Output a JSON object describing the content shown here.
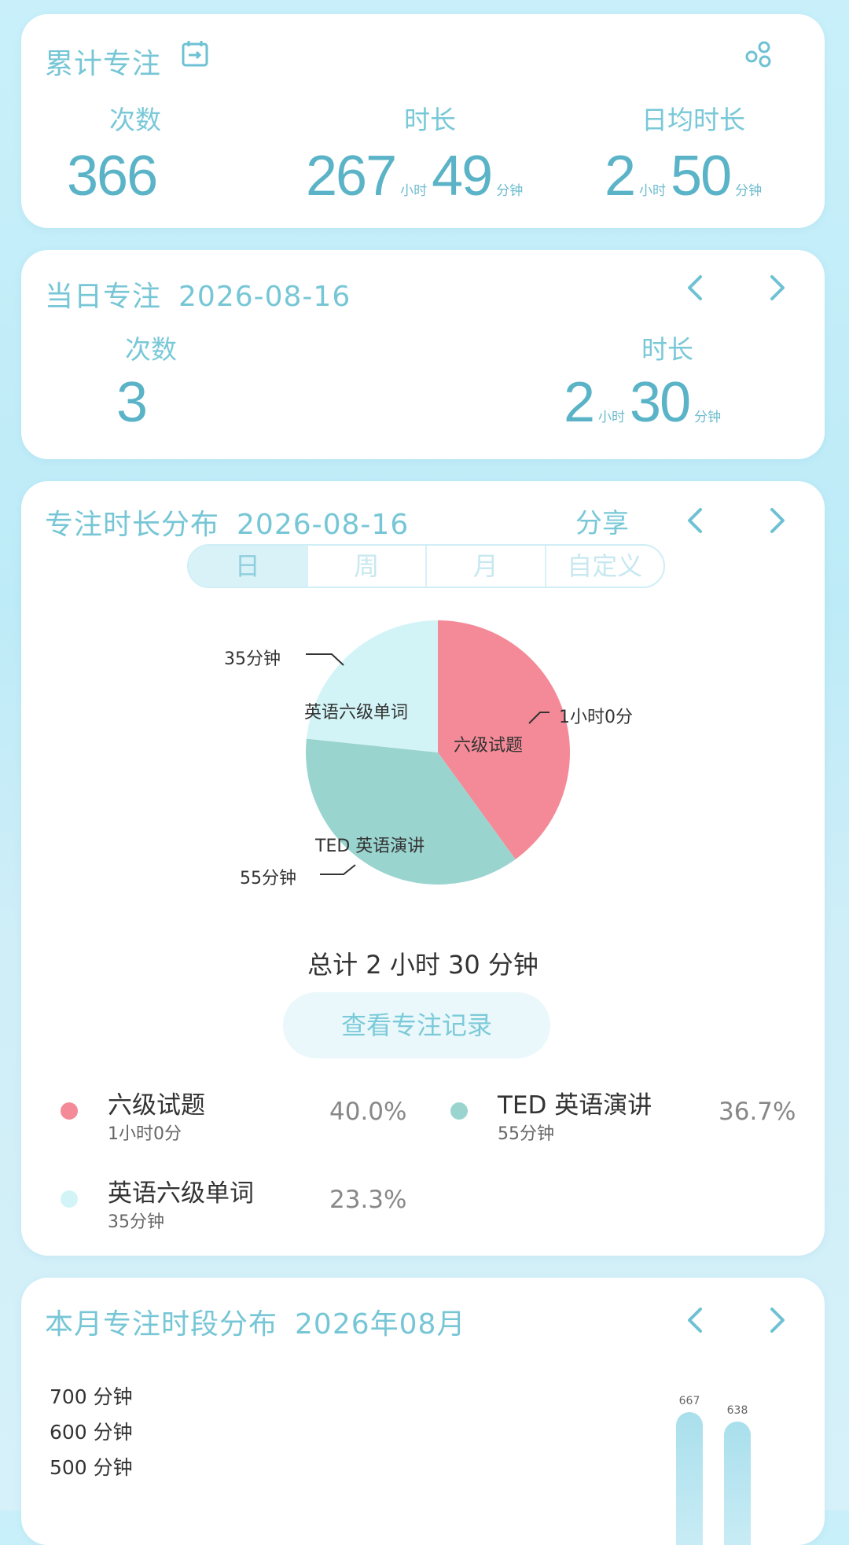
{
  "cumulative": {
    "title": "累计专注",
    "count_label": "次数",
    "count_value": "366",
    "duration_label": "时长",
    "duration_hours": "267",
    "duration_hours_unit": "小时",
    "duration_minutes": "49",
    "duration_minutes_unit": "分钟",
    "daily_avg_label": "日均时长",
    "daily_avg_hours": "2",
    "daily_avg_hours_unit": "小时",
    "daily_avg_minutes": "50",
    "daily_avg_minutes_unit": "分钟"
  },
  "today": {
    "title": "当日专注",
    "date": "2026-08-16",
    "count_label": "次数",
    "count_value": "3",
    "duration_label": "时长",
    "duration_hours": "2",
    "duration_hours_unit": "小时",
    "duration_minutes": "30",
    "duration_minutes_unit": "分钟"
  },
  "distribution": {
    "title": "专注时长分布",
    "date": "2026-08-16",
    "share_label": "分享",
    "tabs": [
      "日",
      "周",
      "月",
      "自定义"
    ],
    "total_text": "总计 2 小时 30 分钟",
    "record_button": "查看专注记录",
    "legend": [
      {
        "name": "六级试题",
        "duration": "1小时0分",
        "percent": "40.0%",
        "color": "#f48a97"
      },
      {
        "name": "TED 英语演讲",
        "duration": "55分钟",
        "percent": "36.7%",
        "color": "#9ad4cf"
      },
      {
        "name": "英语六级单词",
        "duration": "35分钟",
        "percent": "23.3%",
        "color": "#d3f4f7"
      }
    ]
  },
  "chart_data": [
    {
      "type": "pie",
      "values": [
        60,
        55,
        35
      ],
      "categories": [
        "六级试题",
        "TED 英语演讲",
        "英语六级单词"
      ],
      "labels": [
        "1小时0分",
        "55分钟",
        "35分钟"
      ],
      "percentages": [
        40.0,
        36.7,
        23.3
      ],
      "colors": [
        "#f48a97",
        "#9ad4cf",
        "#d3f4f7"
      ]
    },
    {
      "type": "bar",
      "y_ticks": [
        "700 分钟",
        "600 分钟",
        "500 分钟"
      ],
      "values": [
        667,
        638
      ],
      "value_labels": [
        "667",
        "638"
      ]
    }
  ],
  "monthly": {
    "title": "本月专注时段分布",
    "date": "2026年08月"
  }
}
